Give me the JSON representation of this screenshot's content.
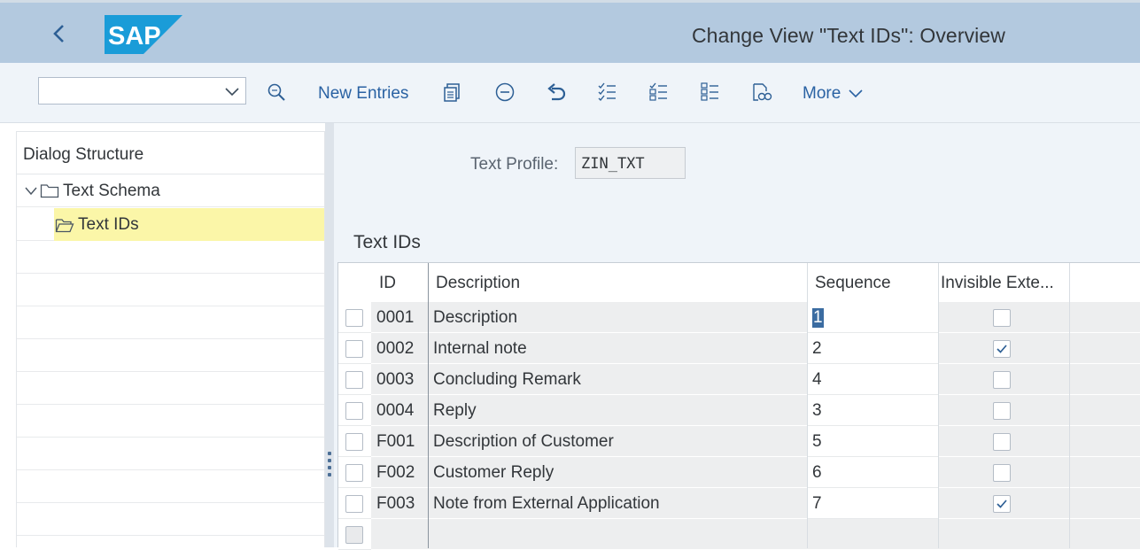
{
  "header": {
    "title": "Change View \"Text IDs\": Overview",
    "logo_text": "SAP",
    "brand_color": "#1a9cd8"
  },
  "toolbar": {
    "command_field": "",
    "new_entries": "New Entries",
    "more": "More",
    "icons": [
      "search-icon",
      "copy-icon",
      "delete-icon",
      "undo-icon",
      "select-all-icon",
      "deselect-all-icon",
      "select-block-icon",
      "print-preview-icon"
    ]
  },
  "dialog_structure": {
    "title": "Dialog Structure",
    "items": [
      {
        "label": "Text Schema",
        "level": 0,
        "expanded": true,
        "selected": false
      },
      {
        "label": "Text IDs",
        "level": 1,
        "expanded": false,
        "selected": true
      }
    ]
  },
  "form": {
    "text_profile_label": "Text Profile:",
    "text_profile_value": "ZIN_TXT"
  },
  "table": {
    "title": "Text IDs",
    "columns": [
      "ID",
      "Description",
      "Sequence",
      "Invisible Exte..."
    ],
    "rows": [
      {
        "id": "0001",
        "description": "Description",
        "sequence": "1",
        "invisible": false
      },
      {
        "id": "0002",
        "description": "Internal note",
        "sequence": "2",
        "invisible": true
      },
      {
        "id": "0003",
        "description": "Concluding Remark",
        "sequence": "4",
        "invisible": false
      },
      {
        "id": "0004",
        "description": "Reply",
        "sequence": "3",
        "invisible": false
      },
      {
        "id": "F001",
        "description": "Description of Customer",
        "sequence": "5",
        "invisible": false
      },
      {
        "id": "F002",
        "description": "Customer Reply",
        "sequence": "6",
        "invisible": false
      },
      {
        "id": "F003",
        "description": "Note from External Application",
        "sequence": "7",
        "invisible": true
      }
    ]
  }
}
